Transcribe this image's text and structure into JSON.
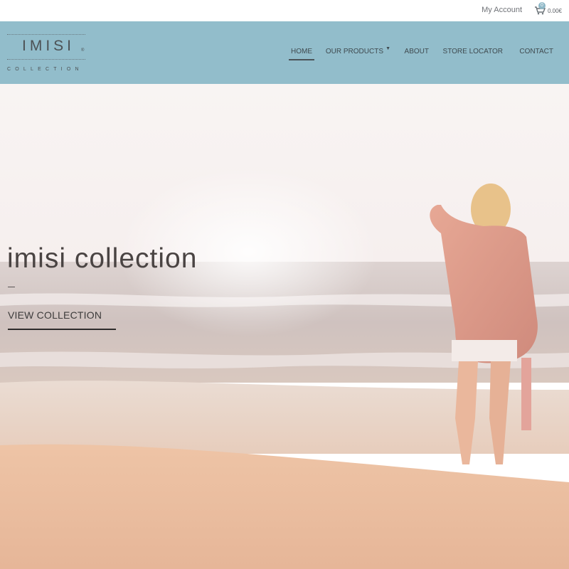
{
  "topbar": {
    "account_label": "My Account",
    "cart": {
      "icon": "cart-icon",
      "count": "0",
      "total": "0.00€"
    }
  },
  "logo": {
    "wordmark": "IMISI",
    "registered": "®",
    "tagline": "COLLECTION"
  },
  "nav": {
    "items": [
      {
        "label": "HOME",
        "active": true
      },
      {
        "label": "OUR PRODUCTS",
        "dropdown": true
      },
      {
        "label": "ABOUT"
      },
      {
        "label": "STORE LOCATOR"
      },
      {
        "label": "CONTACT"
      }
    ]
  },
  "hero": {
    "title": "imisi collection",
    "cta_label": "VIEW COLLECTION",
    "image": "beach-woman-photo"
  },
  "colors": {
    "header_bg": "#92bdcb",
    "accent": "#8fb8c7",
    "text_dark": "#4a4443"
  }
}
